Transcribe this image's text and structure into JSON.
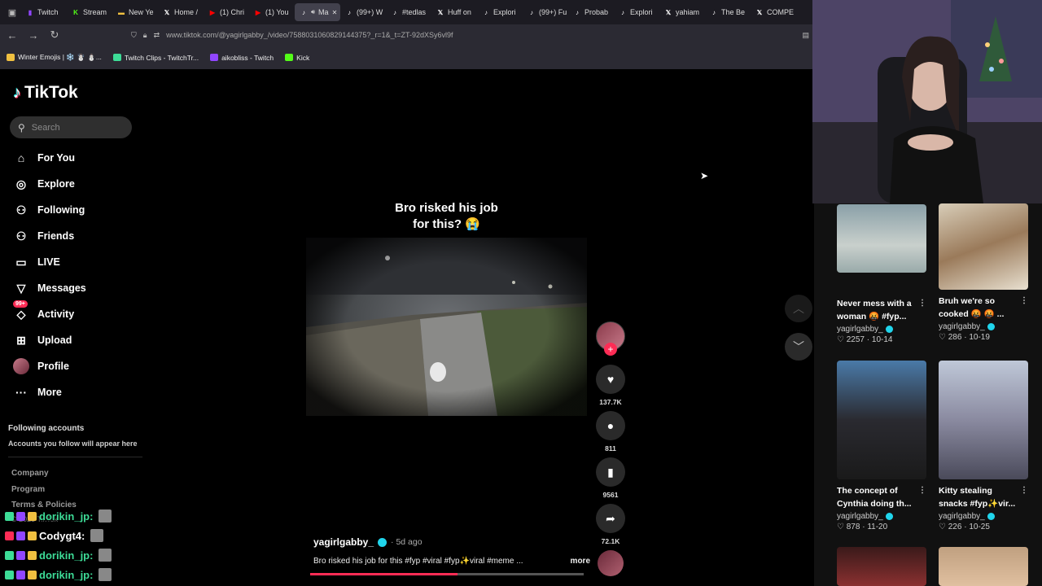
{
  "browser": {
    "tabs": [
      {
        "label": "Twitch",
        "color": "#9146ff",
        "glyph": "▮"
      },
      {
        "label": "Stream",
        "color": "#53fc18",
        "glyph": "K"
      },
      {
        "label": "New Ye",
        "color": "#f0c040",
        "glyph": "▬"
      },
      {
        "label": "Home /",
        "color": "#ffffff",
        "glyph": "𝕏"
      },
      {
        "label": "(1) Chri",
        "color": "#ff0000",
        "glyph": "▶"
      },
      {
        "label": "(1) You",
        "color": "#ff0000",
        "glyph": "▶"
      },
      {
        "label": "Ma",
        "color": "#ffffff",
        "glyph": "♪",
        "active": true
      },
      {
        "label": "(99+) W",
        "color": "#ffffff",
        "glyph": "♪"
      },
      {
        "label": "#tedlas",
        "color": "#ffffff",
        "glyph": "♪"
      },
      {
        "label": "Huff on",
        "color": "#ffffff",
        "glyph": "𝕏"
      },
      {
        "label": "Explori",
        "color": "#ffffff",
        "glyph": "♪"
      },
      {
        "label": "(99+) Fu",
        "color": "#ffffff",
        "glyph": "♪"
      },
      {
        "label": "Probab",
        "color": "#ffffff",
        "glyph": "♪"
      },
      {
        "label": "Explori",
        "color": "#ffffff",
        "glyph": "♪"
      },
      {
        "label": "yahiam",
        "color": "#ffffff",
        "glyph": "𝕏"
      },
      {
        "label": "The Be",
        "color": "#ffffff",
        "glyph": "♪"
      },
      {
        "label": "COMPE",
        "color": "#ffffff",
        "glyph": "𝕏"
      }
    ],
    "url": "www.tiktok.com/@yagirlgabby_/video/7588031060829144375?_r=1&_t=ZT-92dXSy6vl9f",
    "bookmarks": [
      {
        "label": "Winter Emojis | ❄️ ☃️ ⛄...",
        "color": "#f0c040"
      },
      {
        "label": "Twitch Clips - TwitchTr...",
        "color": "#3ddc97"
      },
      {
        "label": "aikobliss - Twitch",
        "color": "#9146ff"
      },
      {
        "label": "Kick",
        "color": "#53fc18"
      }
    ]
  },
  "sidebar": {
    "logo": "TikTok",
    "search_placeholder": "Search",
    "nav": [
      {
        "label": "For You",
        "icon": "home-icon",
        "glyph": "⌂"
      },
      {
        "label": "Explore",
        "icon": "compass-icon",
        "glyph": "◎"
      },
      {
        "label": "Following",
        "icon": "following-icon",
        "glyph": "⚇"
      },
      {
        "label": "Friends",
        "icon": "friends-icon",
        "glyph": "⚇"
      },
      {
        "label": "LIVE",
        "icon": "live-icon",
        "glyph": "▭"
      },
      {
        "label": "Messages",
        "icon": "messages-icon",
        "glyph": "▽"
      },
      {
        "label": "Activity",
        "icon": "activity-icon",
        "glyph": "◇",
        "badge": "99+"
      },
      {
        "label": "Upload",
        "icon": "upload-icon",
        "glyph": "⊞"
      },
      {
        "label": "Profile",
        "icon": "profile-avatar-icon",
        "glyph": ""
      },
      {
        "label": "More",
        "icon": "more-icon",
        "glyph": "···"
      }
    ],
    "following_title": "Following accounts",
    "following_subtitle": "Accounts you follow will appear here",
    "footer": [
      "Company",
      "Program",
      "Terms & Policies"
    ],
    "copyright": "© 2025 TikTok"
  },
  "video": {
    "caption_line1": "Bro risked his job",
    "caption_line2": "for this? 😭",
    "author": "yagirlgabby_",
    "age": "· 5d ago",
    "description": "Bro risked his job for this #fyp #viral #fyp✨viral #meme ...",
    "more_label": "more",
    "likes": "137.7K",
    "comments": "811",
    "saves": "9561",
    "shares": "72.1K",
    "progress": 0.54
  },
  "recommended": [
    {
      "title": "Never mess with a woman 🤬 #fyp...",
      "author": "yagirlgabby_",
      "likes": "2257",
      "date": "10-14"
    },
    {
      "title": "Bruh we're so cooked 🤬 🤬 ...",
      "author": "yagirlgabby_",
      "likes": "286",
      "date": "10-19"
    },
    {
      "title": "The concept of Cynthia doing th...",
      "author": "yagirlgabby_",
      "likes": "878",
      "date": "11-20"
    },
    {
      "title": "Kitty stealing snacks #fyp✨vir...",
      "author": "yagirlgabby_",
      "likes": "226",
      "date": "10-25"
    }
  ],
  "chat": [
    {
      "user": "dorikin_jp:",
      "color": "#3ddc97"
    },
    {
      "user": "Codygt4:",
      "color": "#ffffff"
    },
    {
      "user": "dorikin_jp:",
      "color": "#3ddc97"
    },
    {
      "user": "dorikin_jp:",
      "color": "#3ddc97"
    }
  ]
}
